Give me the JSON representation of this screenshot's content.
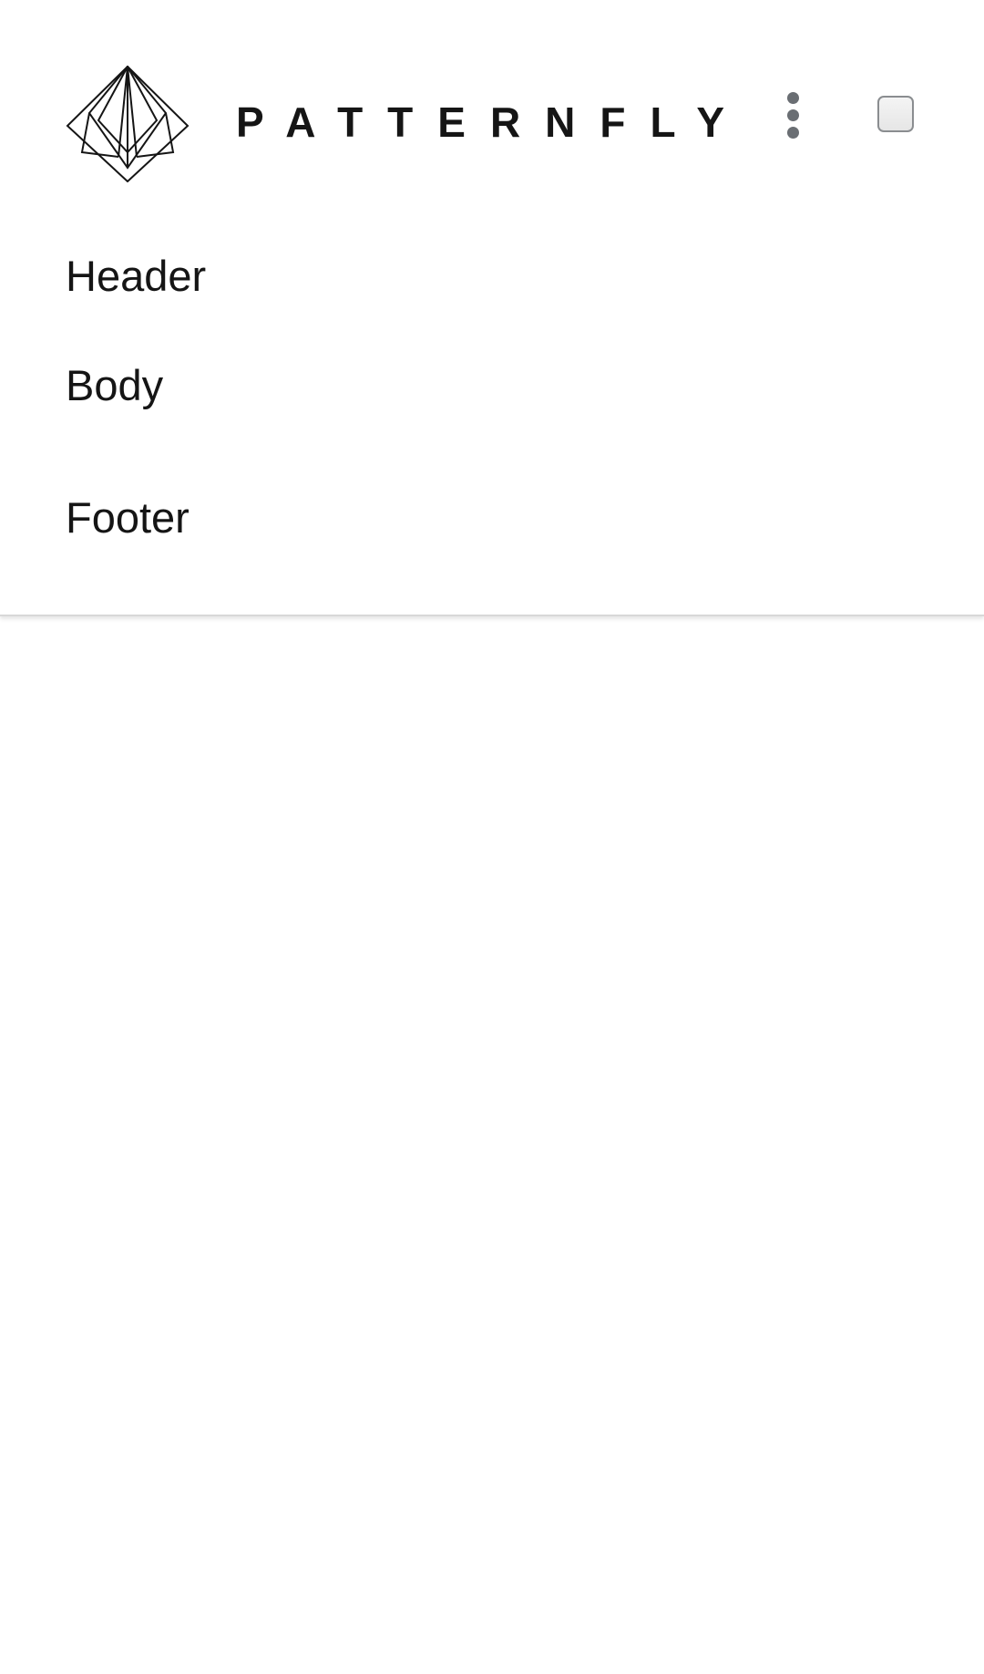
{
  "card": {
    "brand": {
      "name": "PATTERNFLY",
      "logo_icon": "patternfly-logo-icon"
    },
    "actions": {
      "kebab_icon": "kebab-menu-icon",
      "checkbox_checked": false
    },
    "header": "Header",
    "body": "Body",
    "footer": "Footer"
  },
  "colors": {
    "text": "#151515",
    "icon_gray": "#6a6e73",
    "divider": "#d8d8d8",
    "background": "#ffffff"
  }
}
